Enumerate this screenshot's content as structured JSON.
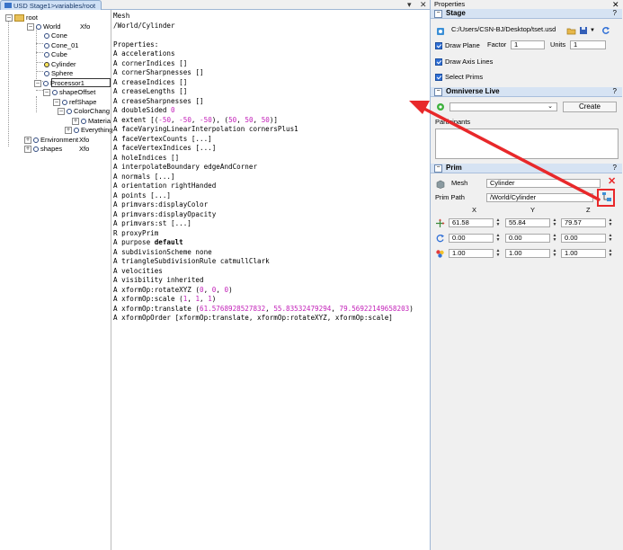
{
  "window": {
    "tab_title": "USD Stage1>variables/root",
    "dropdown_glyph": "▾",
    "close_glyph": "✕"
  },
  "tree": {
    "items": [
      {
        "label": "root",
        "expand": "⊟",
        "type": "folder"
      },
      {
        "label": "World",
        "expand": "⊟",
        "type": "prim",
        "suffix": "Xfo"
      },
      {
        "label": "Cone",
        "type": "prim"
      },
      {
        "label": "Cone_01",
        "type": "prim"
      },
      {
        "label": "Cube",
        "type": "prim"
      },
      {
        "label": "Cylinder",
        "type": "prim",
        "selected": true
      },
      {
        "label": "Sphere",
        "type": "prim"
      },
      {
        "label": "Processor1",
        "expand": "⊟",
        "type": "prim"
      },
      {
        "label": "shapeOffset",
        "expand": "⊟",
        "type": "prim"
      },
      {
        "label": "refShape",
        "expand": "⊟",
        "type": "prim"
      },
      {
        "label": "ColorChang",
        "expand": "⊟",
        "type": "prim"
      },
      {
        "label": "Materia",
        "expand": "⊞",
        "type": "prim"
      },
      {
        "label": "Everything",
        "expand": "⊞",
        "type": "prim"
      },
      {
        "label": "Environment",
        "expand": "⊞",
        "type": "prim",
        "suffix": "Xfo"
      },
      {
        "label": "shapes",
        "expand": "⊞",
        "type": "prim",
        "suffix": "Xfo"
      }
    ]
  },
  "textpane": {
    "lines": [
      [
        {
          "t": "Mesh"
        }
      ],
      [
        {
          "t": "/World/Cylinder"
        }
      ],
      [
        {
          "t": ""
        }
      ],
      [
        {
          "t": "Properties:"
        }
      ],
      [
        {
          "t": "A accelerations"
        }
      ],
      [
        {
          "t": "A cornerIndices []"
        }
      ],
      [
        {
          "t": "A cornerSharpnesses []"
        }
      ],
      [
        {
          "t": "A creaseIndices []"
        }
      ],
      [
        {
          "t": "A creaseLengths []"
        }
      ],
      [
        {
          "t": "A creaseSharpnesses []"
        }
      ],
      [
        {
          "t": "A doubleSided "
        },
        {
          "t": "0",
          "c": "num"
        }
      ],
      [
        {
          "t": "A extent [("
        },
        {
          "t": "-50",
          "c": "num"
        },
        {
          "t": ", "
        },
        {
          "t": "-50",
          "c": "num"
        },
        {
          "t": ", "
        },
        {
          "t": "-50",
          "c": "num"
        },
        {
          "t": "), ("
        },
        {
          "t": "50",
          "c": "num"
        },
        {
          "t": ", "
        },
        {
          "t": "50",
          "c": "num"
        },
        {
          "t": ", "
        },
        {
          "t": "50",
          "c": "num"
        },
        {
          "t": ")]"
        }
      ],
      [
        {
          "t": "A faceVaryingLinearInterpolation cornersPlus1"
        }
      ],
      [
        {
          "t": "A faceVertexCounts [...]"
        }
      ],
      [
        {
          "t": "A faceVertexIndices [...]"
        }
      ],
      [
        {
          "t": "A holeIndices []"
        }
      ],
      [
        {
          "t": "A interpolateBoundary edgeAndCorner"
        }
      ],
      [
        {
          "t": "A normals [...]"
        }
      ],
      [
        {
          "t": "A orientation rightHanded"
        }
      ],
      [
        {
          "t": "A points [...]"
        }
      ],
      [
        {
          "t": "A primvars:displayColor"
        }
      ],
      [
        {
          "t": "A primvars:displayOpacity"
        }
      ],
      [
        {
          "t": "A primvars:st [...]"
        }
      ],
      [
        {
          "t": "R proxyPrim"
        }
      ],
      [
        {
          "t": "A purpose "
        },
        {
          "t": "default",
          "c": "bold"
        }
      ],
      [
        {
          "t": "A subdivisionScheme none"
        }
      ],
      [
        {
          "t": "A triangleSubdivisionRule catmullClark"
        }
      ],
      [
        {
          "t": "A velocities"
        }
      ],
      [
        {
          "t": "A visibility inherited"
        }
      ],
      [
        {
          "t": "A xformOp:rotateXYZ ("
        },
        {
          "t": "0",
          "c": "num"
        },
        {
          "t": ", "
        },
        {
          "t": "0",
          "c": "num"
        },
        {
          "t": ", "
        },
        {
          "t": "0",
          "c": "num"
        },
        {
          "t": ")"
        }
      ],
      [
        {
          "t": "A xformOp:scale ("
        },
        {
          "t": "1",
          "c": "num"
        },
        {
          "t": ", "
        },
        {
          "t": "1",
          "c": "num"
        },
        {
          "t": ", "
        },
        {
          "t": "1",
          "c": "num"
        },
        {
          "t": ")"
        }
      ],
      [
        {
          "t": "A xformOp:translate ("
        },
        {
          "t": "61.5768928527832",
          "c": "num"
        },
        {
          "t": ", "
        },
        {
          "t": "55.83532479294",
          "c": "num"
        },
        {
          "t": ", "
        },
        {
          "t": "79.56922149658203",
          "c": "num"
        },
        {
          "t": ")"
        }
      ],
      [
        {
          "t": "A xformOpOrder [xformOp:translate, xformOp:rotateXYZ, xformOp:scale]"
        }
      ]
    ]
  },
  "properties": {
    "title": "Properties",
    "close_glyph": "✕",
    "stage": {
      "header": "Stage",
      "help": "?",
      "path": "C:/Users/CSN-BJ/Desktop/tset.usd",
      "draw_plane_label": "Draw Plane",
      "factor_label": "Factor",
      "factor_value": "1",
      "units_label": "Units",
      "units_value": "1",
      "draw_axis_label": "Draw Axis Lines",
      "select_prims_label": "Select Prims"
    },
    "omniverse": {
      "header": "Omniverse Live",
      "help": "?",
      "create_label": "Create",
      "participants_label": "Participants"
    },
    "prim": {
      "header": "Prim",
      "help": "?",
      "type_label": "Mesh",
      "name_value": "Cylinder",
      "path_label": "Prim Path",
      "path_value": "/World/Cylinder",
      "x_label": "X",
      "y_label": "Y",
      "z_label": "Z",
      "translate": [
        "61.58",
        "55.84",
        "79.57"
      ],
      "rotate": [
        "0.00",
        "0.00",
        "0.00"
      ],
      "scale": [
        "1.00",
        "1.00",
        "1.00"
      ]
    }
  },
  "colors": {
    "annotation_red": "#e8282a",
    "checkbox_blue": "#2f6fd6",
    "value_magenta": "#c21fb8"
  }
}
